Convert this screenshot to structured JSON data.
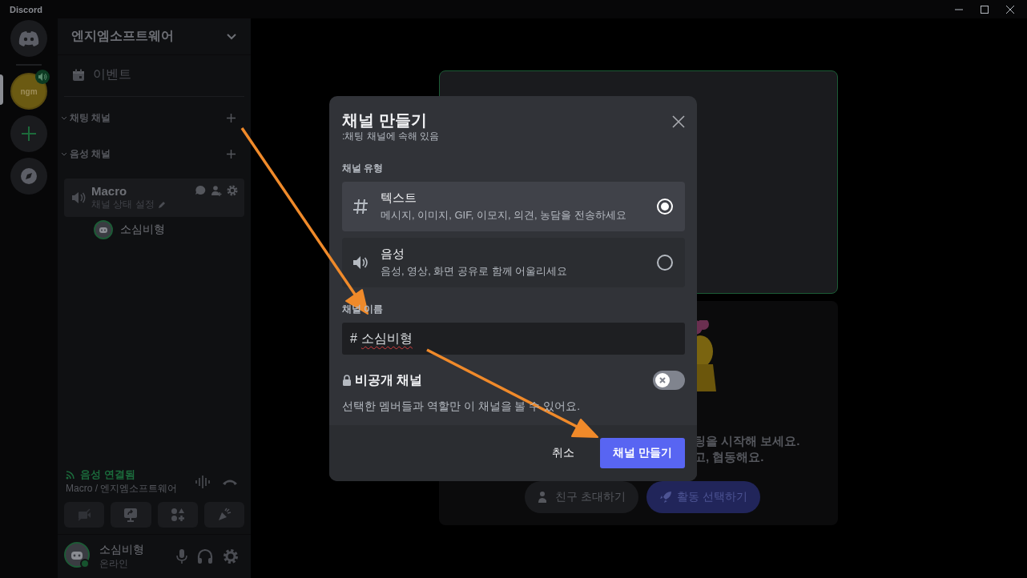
{
  "window": {
    "title": "Discord"
  },
  "servers": [
    {
      "label": "ngm",
      "selected": true,
      "voice_active": true
    }
  ],
  "server": {
    "name": "엔지엠소프트웨어"
  },
  "sidebar": {
    "events_label": "이벤트",
    "categories": [
      {
        "name": "채팅 채널",
        "expanded": true
      },
      {
        "name": "음성 채널",
        "expanded": true,
        "channels": [
          {
            "kind": "voice",
            "name": "Macro",
            "status": "채널 상태 설정",
            "members": [
              {
                "name": "소심비형"
              }
            ]
          }
        ]
      }
    ]
  },
  "voice_panel": {
    "status": "음성 연결됨",
    "location": "Macro / 엔지엠소프트웨어"
  },
  "user_panel": {
    "name": "소심비형",
    "status": "온라인"
  },
  "stage": {
    "hint_lines": [
      "팅을 시작해 보세요.",
      "고, 협동해요."
    ],
    "buttons": [
      {
        "kind": "invite",
        "label": "친구 초대하기"
      },
      {
        "kind": "activity",
        "label": "활동 선택하기"
      }
    ]
  },
  "modal": {
    "title": "채널 만들기",
    "subtitle": ":채팅 채널에 속해 있음",
    "type_label": "채널 유형",
    "types": [
      {
        "kind": "text",
        "name": "텍스트",
        "description": "메시지, 이미지, GIF, 이모지, 의견, 농담을 전송하세요",
        "selected": true
      },
      {
        "kind": "voice",
        "name": "음성",
        "description": "음성, 영상, 화면 공유로 함께 어울리세요",
        "selected": false
      }
    ],
    "name_label": "채널 이름",
    "name_prefix": "#",
    "name_value": "소심비형",
    "private": {
      "label": "비공개 채널",
      "on": false,
      "description": "선택한 멤버들과 역할만 이 채널을 볼 수 있어요."
    },
    "cancel": "취소",
    "submit": "채널 만들기"
  }
}
